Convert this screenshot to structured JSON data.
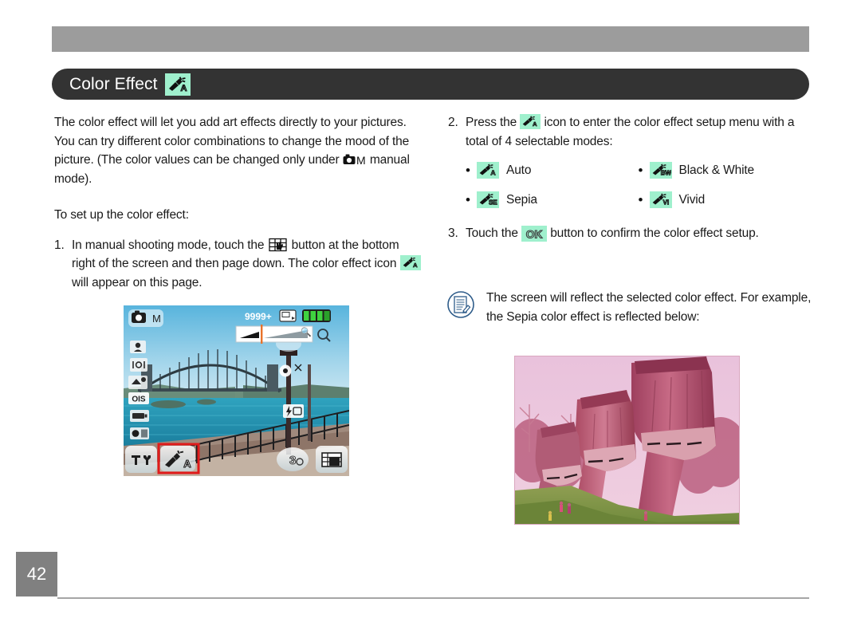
{
  "page": {
    "number": "42",
    "title": "Color Effect"
  },
  "colors": {
    "title_bar": "#333333",
    "top_bar": "#9c9c9c",
    "icon_chip": "#9ff0cd",
    "page_box": "#808080",
    "note_accent": "#2e5c8a"
  },
  "left_column": {
    "intro": "The color effect will let you add art effects directly to your pictures. You can try different color combinations to change the mood of the picture. (The color values can be changed only under ",
    "intro_after_icon": " manual mode).",
    "intro_icon": "camera-manual-mode-icon",
    "subhead": "To set up the color effect:",
    "step1_number": "1.",
    "step1_part1": "In manual shooting mode, touch the ",
    "step1_icon1": "grid-touch-button-icon",
    "step1_part2": " button at the bottom right of the screen and then page down. The color effect icon ",
    "step1_icon2": "color-effect-auto-icon",
    "step1_part3": " will appear on this page."
  },
  "right_column": {
    "step2_number": "2.",
    "step2_part1": "Press the ",
    "step2_icon": "color-effect-auto-icon",
    "step2_part2": " icon to enter the color effect setup menu with a total of 4 selectable modes:",
    "modes": [
      {
        "icon_label": "A",
        "icon_name": "color-effect-auto-icon",
        "label": "Auto"
      },
      {
        "icon_label": "BW",
        "icon_name": "color-effect-black-white-icon",
        "label": "Black & White"
      },
      {
        "icon_label": "SE",
        "icon_name": "color-effect-sepia-icon",
        "label": "Sepia"
      },
      {
        "icon_label": "VI",
        "icon_name": "color-effect-vivid-icon",
        "label": "Vivid"
      }
    ],
    "step3_number": "3.",
    "step3_part1": "Touch the ",
    "step3_icon": "ok-button-icon",
    "step3_icon_label": "OK",
    "step3_part2": " button to confirm the color effect setup."
  },
  "note": {
    "icon": "note-pad-pencil-icon",
    "text": "The screen will reflect the selected color effect. For example, the Sepia color effect is reflected below:"
  },
  "camera_screen": {
    "caption": "camera-lcd-live-view",
    "mode_badge": "camera-manual-mode-badge",
    "shots_remaining": "9999+",
    "storage_icon": "sd-card-icon",
    "battery_icon": "battery-full-icon",
    "zoom_slider": "zoom-slider",
    "zoom_in_icon": "magnifier-plus-icon",
    "zoom_out_icon": "magnifier-icon",
    "left_icons": [
      "face-detection-icon",
      "af-frame-icon",
      "white-balance-icon",
      "ois-icon",
      "battery-type-icon",
      "exposure-icon"
    ],
    "ois_label": "OIS",
    "right_icons": [
      "af-target-icon",
      "flash-icon"
    ],
    "bottom_icons": [
      "tools-wrench-icon",
      "color-effect-auto-icon",
      "self-timer-icon",
      "page-grid-icon"
    ],
    "self_timer_label": "3",
    "highlight": "red-highlight-box-around-color-effect-icon"
  },
  "sample_photo": {
    "caption": "sepia-effect-sample-photo",
    "subject": "stone viaduct arches"
  }
}
